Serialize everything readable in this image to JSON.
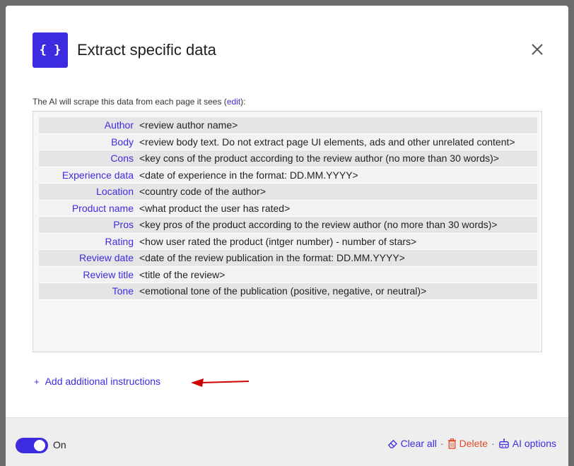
{
  "dialog": {
    "icon_glyph": "{ }",
    "title": "Extract specific data",
    "intro_text": "The AI will scrape this data from each page it sees (",
    "intro_link": "edit",
    "intro_suffix": "):"
  },
  "fields": [
    {
      "key": "Author",
      "value": "<review author name>"
    },
    {
      "key": "Body",
      "value": "<review body text. Do not extract page UI elements, ads and other unrelated content>"
    },
    {
      "key": "Cons",
      "value": "<key cons of the product according to the review author (no more than 30 words)>"
    },
    {
      "key": "Experience data",
      "value": "<date of experience in the format: DD.MM.YYYY>"
    },
    {
      "key": "Location",
      "value": "<country code of the author>"
    },
    {
      "key": "Product name",
      "value": "<what product the user has rated>"
    },
    {
      "key": "Pros",
      "value": "<key pros of the product according to the review author (no more than 30 words)>"
    },
    {
      "key": "Rating",
      "value": "<how user rated the product (intger number) - number of stars>"
    },
    {
      "key": "Review date",
      "value": "<date of the review publication in the format: DD.MM.YYYY>"
    },
    {
      "key": "Review title",
      "value": "<title of the review>"
    },
    {
      "key": "Tone",
      "value": "<emotional tone of the publication (positive, negative, or neutral)>"
    }
  ],
  "add_instructions": {
    "plus": "+",
    "label": "Add additional instructions"
  },
  "footer": {
    "toggle_on": true,
    "toggle_label": "On",
    "clear_all": "Clear all",
    "delete": "Delete",
    "ai_options": "AI options",
    "separator": "·"
  },
  "colors": {
    "accent": "#3d2be0",
    "danger": "#e04a2b",
    "annotation_arrow": "#d00000"
  }
}
